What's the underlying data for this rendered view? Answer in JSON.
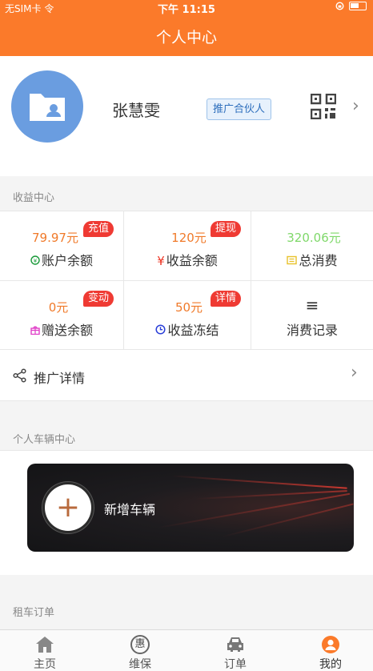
{
  "status_bar": {
    "carrier": "无SIM卡 令",
    "time": "下午 11:15"
  },
  "header": {
    "title": "个人中心"
  },
  "profile": {
    "name": "张慧雯",
    "tag": "推广合伙人",
    "chevron": "›"
  },
  "earnings": {
    "section_title": "收益中心",
    "cells": [
      {
        "value": "79.97元",
        "label": "账户余额",
        "badge": "充值",
        "value_color": "#f07a2a"
      },
      {
        "value": "120元",
        "label": "收益余额",
        "badge": "提现",
        "value_color": "#f07a2a"
      },
      {
        "value": "320.06元",
        "label": "总消费",
        "badge": "",
        "value_color": "#7fd86a"
      },
      {
        "value": "0元",
        "label": "赠送余额",
        "badge": "变动",
        "value_color": "#f07a2a"
      },
      {
        "value": "50元",
        "label": "收益冻结",
        "badge": "详情",
        "value_color": "#f07a2a"
      },
      {
        "value": "",
        "label": "消费记录",
        "badge": "",
        "value_color": "#333333"
      }
    ],
    "icons": [
      "coin-icon",
      "yen-icon",
      "receipt-icon",
      "gift-icon",
      "clock-icon",
      "list-icon"
    ],
    "icon_glyphs": {
      "yen": "¥",
      "list": "≡"
    }
  },
  "promo": {
    "label": "推广详情",
    "chevron": "›"
  },
  "vehicle": {
    "section_title": "个人车辆中心",
    "add_label": "新增车辆",
    "add_glyph": "+"
  },
  "rental": {
    "section_title": "租车订单"
  },
  "tabs": [
    {
      "label": "主页",
      "icon": "home-icon"
    },
    {
      "label": "维保",
      "icon": "maintenance-icon",
      "glyph": "惠"
    },
    {
      "label": "订单",
      "icon": "car-icon"
    },
    {
      "label": "我的",
      "icon": "user-icon"
    }
  ],
  "colors": {
    "accent": "#fb7a2a",
    "badge": "#ef3a33",
    "tag_text": "#2e6fbd",
    "avatar": "#6a9de0"
  }
}
